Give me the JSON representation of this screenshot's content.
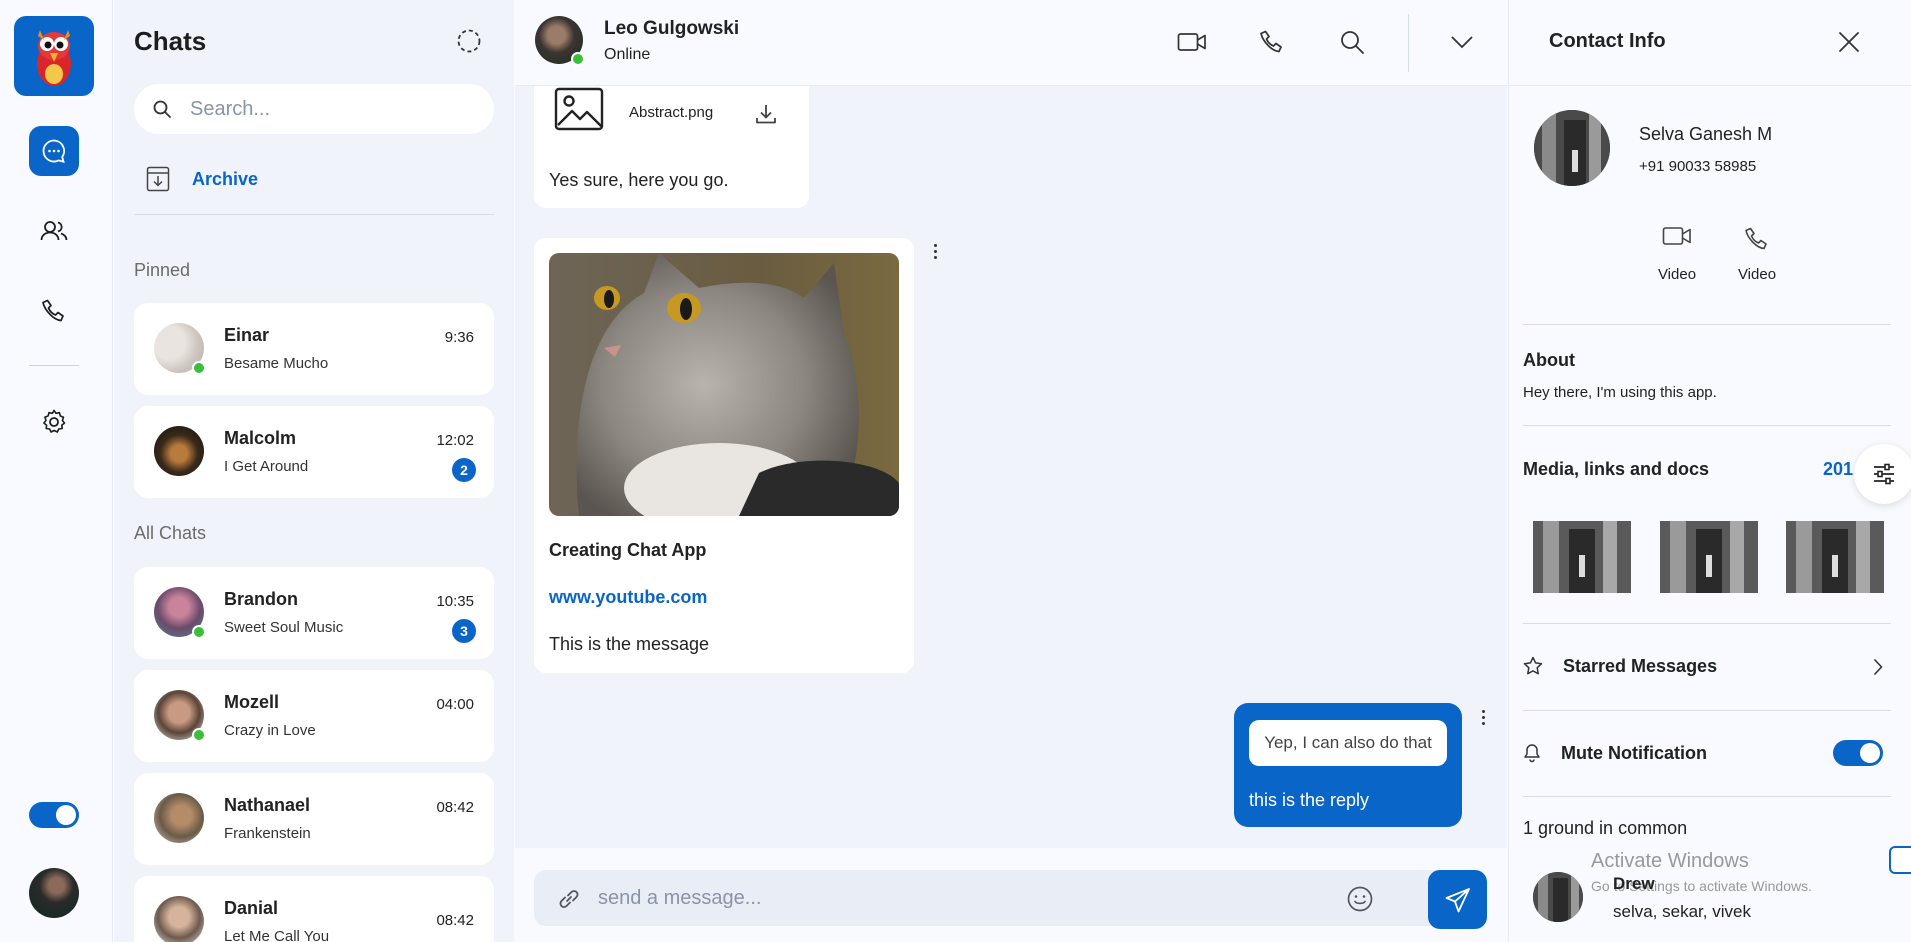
{
  "colors": {
    "accent": "#0a65c8",
    "online": "#3bbf3b",
    "panel_bg": "#f0f4fa"
  },
  "rail": {
    "items": [
      {
        "icon": "chat-bubble-icon",
        "active": true
      },
      {
        "icon": "users-icon",
        "active": false
      },
      {
        "icon": "phone-icon",
        "active": false
      },
      {
        "icon": "gear-icon",
        "active": false
      }
    ],
    "theme_toggle_on": true
  },
  "chats": {
    "title": "Chats",
    "search_placeholder": "Search...",
    "archive_label": "Archive",
    "pinned_label": "Pinned",
    "all_label": "All Chats",
    "pinned": [
      {
        "name": "Einar",
        "message": "Besame Mucho",
        "time": "9:36",
        "online": true
      },
      {
        "name": "Malcolm",
        "message": "I Get Around",
        "time": "12:02",
        "unread": "2"
      }
    ],
    "all": [
      {
        "name": "Brandon",
        "message": "Sweet Soul Music",
        "time": "10:35",
        "unread": "3",
        "online": true
      },
      {
        "name": "Mozell",
        "message": "Crazy in Love",
        "time": "04:00",
        "online": true
      },
      {
        "name": "Nathanael",
        "message": "Frankenstein",
        "time": "08:42"
      },
      {
        "name": "Danial",
        "message": "Let Me Call You",
        "time": "08:42"
      }
    ]
  },
  "conversation": {
    "contact_name": "Leo Gulgowski",
    "contact_status": "Online",
    "header_icons": [
      "video-camera-icon",
      "phone-icon",
      "search-icon",
      "chevron-down-icon"
    ],
    "file_message": {
      "file_name": "Abstract.png",
      "caption": "Yes sure, here you go."
    },
    "link_message": {
      "title": "Creating Chat App",
      "url": "www.youtube.com",
      "text": "This is the message"
    },
    "reply_message": {
      "quoted": "Yep, I can also do that",
      "text": "this is the reply"
    },
    "composer_placeholder": "send a message..."
  },
  "contact_info": {
    "title": "Contact Info",
    "name": "Selva Ganesh M",
    "phone": "+91 90033 58985",
    "actions": [
      "Video",
      "Video"
    ],
    "about_label": "About",
    "about_text": "Hey there, I'm using this app.",
    "media_label": "Media, links and docs",
    "media_count": "201",
    "starred_label": "Starred Messages",
    "mute_label": "Mute Notification",
    "mute_on": true,
    "common_label": "1 ground in common",
    "group_name": "Drew",
    "group_members": "selva, sekar, vivek"
  },
  "watermark": {
    "title": "Activate Windows",
    "subtitle": "Go to Settings to activate Windows."
  }
}
